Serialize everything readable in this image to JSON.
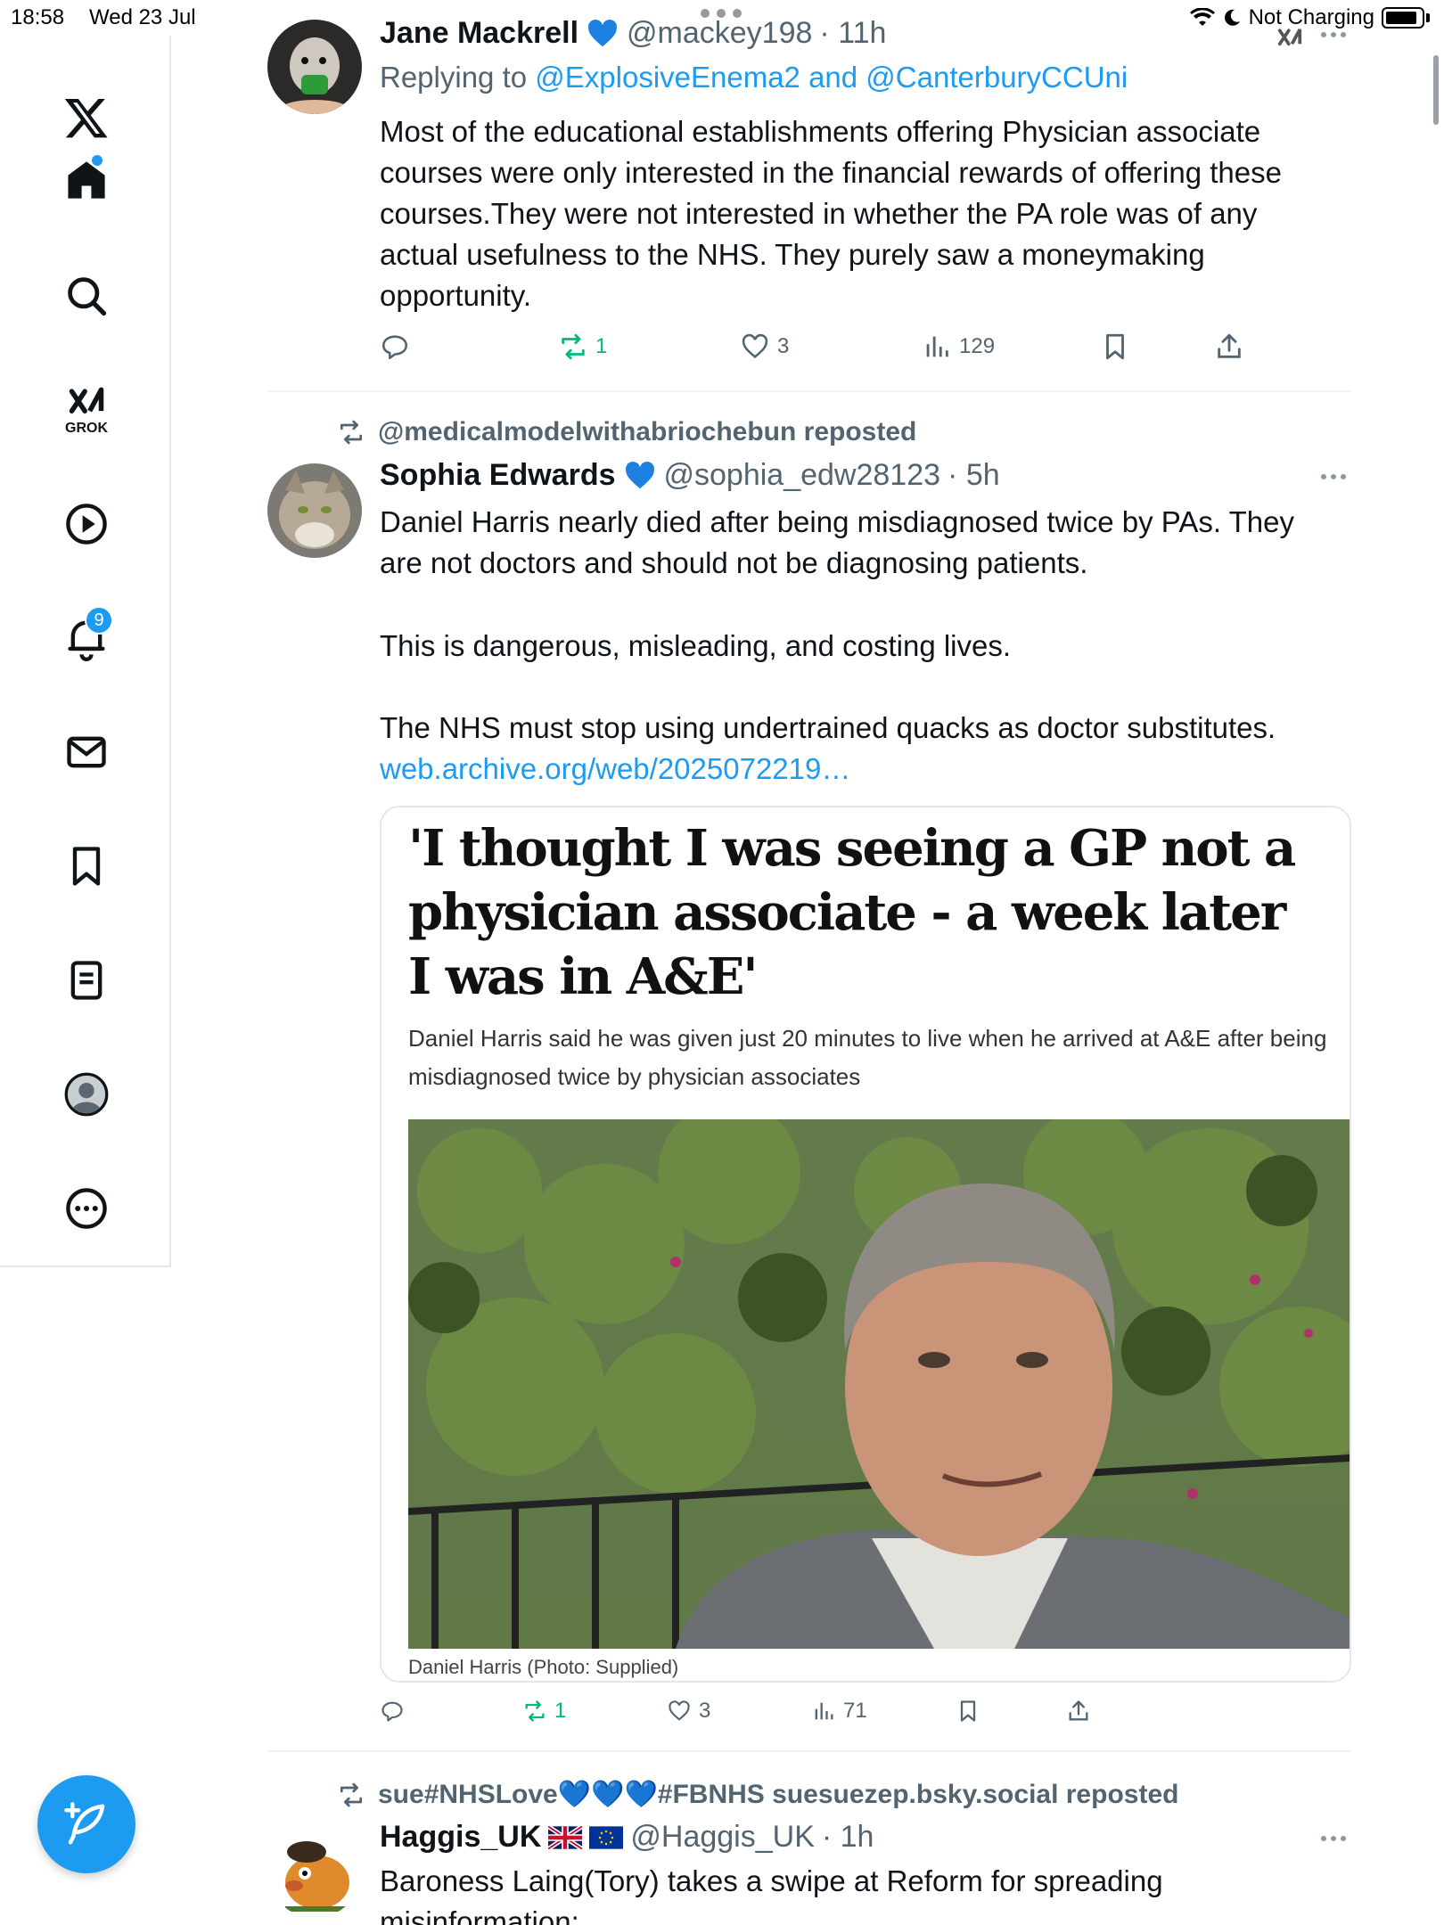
{
  "status_bar": {
    "time": "18:58",
    "date": "Wed 23 Jul",
    "charging": "Not Charging"
  },
  "sidebar": {
    "grok_label": "GROK",
    "notifications_count": "9"
  },
  "tweets": [
    {
      "name": "Jane Mackrell",
      "handle": "@mackey198",
      "time": "· 11h",
      "reply_prefix": "Replying to ",
      "reply_to": "@ExplosiveEnema2 and @CanterburyCCUni",
      "text": "Most of the educational establishments offering Physician associate courses were only interested in the financial rewards of offering these courses.They were not interested in whether the PA role was of any actual usefulness to the NHS. They purely saw a moneymaking opportunity.",
      "replies": "",
      "reposts": "1",
      "likes": "3",
      "views": "129"
    },
    {
      "reposted_by": "@medicalmodelwithabriochebun reposted",
      "name": "Sophia Edwards",
      "handle": "@sophia_edw28123",
      "time": "· 5h",
      "text_p1": "Daniel Harris nearly died after being misdiagnosed twice by PAs. They are not doctors and should not be diagnosing patients.",
      "text_p2": "This is dangerous, misleading, and costing lives.",
      "text_p3": "The NHS must stop using undertrained quacks as doctor substitutes.",
      "link": "web.archive.org/web/2025072219…",
      "card": {
        "headline": "'I thought I was seeing a GP not a physician associate - a week later I was in A&E'",
        "subtitle": "Daniel Harris said he was given just 20 minutes to live when he arrived at A&E after being misdiagnosed twice by physician associates",
        "caption": "Daniel Harris (Photo: Supplied)"
      },
      "reposts": "1",
      "likes": "3",
      "views": "71"
    },
    {
      "reposted_by": "sue#NHSLove💙💙💙#FBNHS suesuezep.bsky.social reposted",
      "name": "Haggis_UK",
      "handle": "@Haggis_UK",
      "time": "· 1h",
      "text": "Baroness Laing(Tory) takes a swipe at Reform for spreading",
      "text_cut": "misinformation:"
    }
  ],
  "colors": {
    "accent": "#1d9bf0",
    "repost_green": "#00ba7c",
    "secondary_text": "#536471"
  }
}
